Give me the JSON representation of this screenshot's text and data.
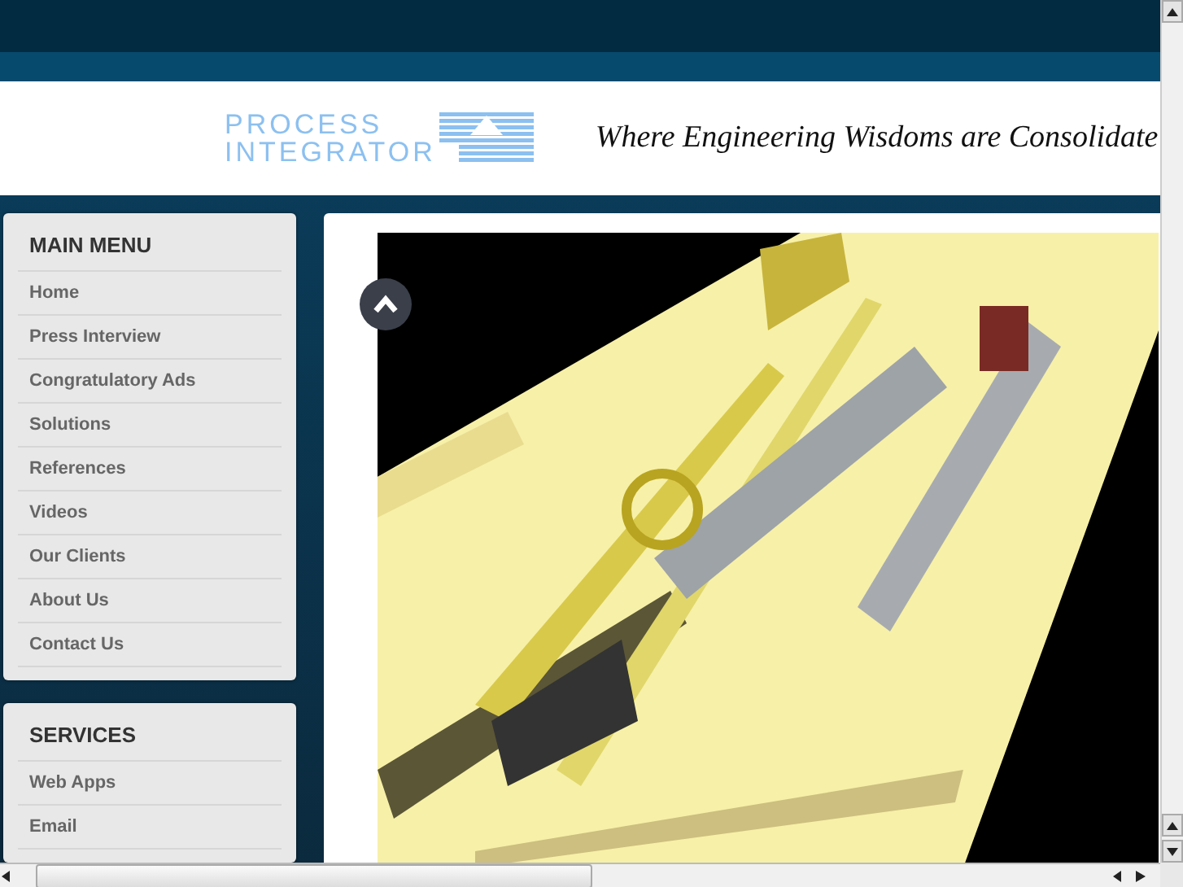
{
  "header": {
    "logo_top": "PROCESS",
    "logo_bottom": "INTEGRATOR",
    "tagline": "Where Engineering Wisdoms are Consolidate"
  },
  "main_menu": {
    "title": "MAIN MENU",
    "items": [
      "Home",
      "Press Interview",
      "Congratulatory Ads",
      "Solutions",
      "References",
      "Videos",
      "Our Clients",
      "About Us",
      "Contact Us"
    ]
  },
  "services": {
    "title": "SERVICES",
    "items": [
      "Web Apps",
      "Email"
    ]
  }
}
